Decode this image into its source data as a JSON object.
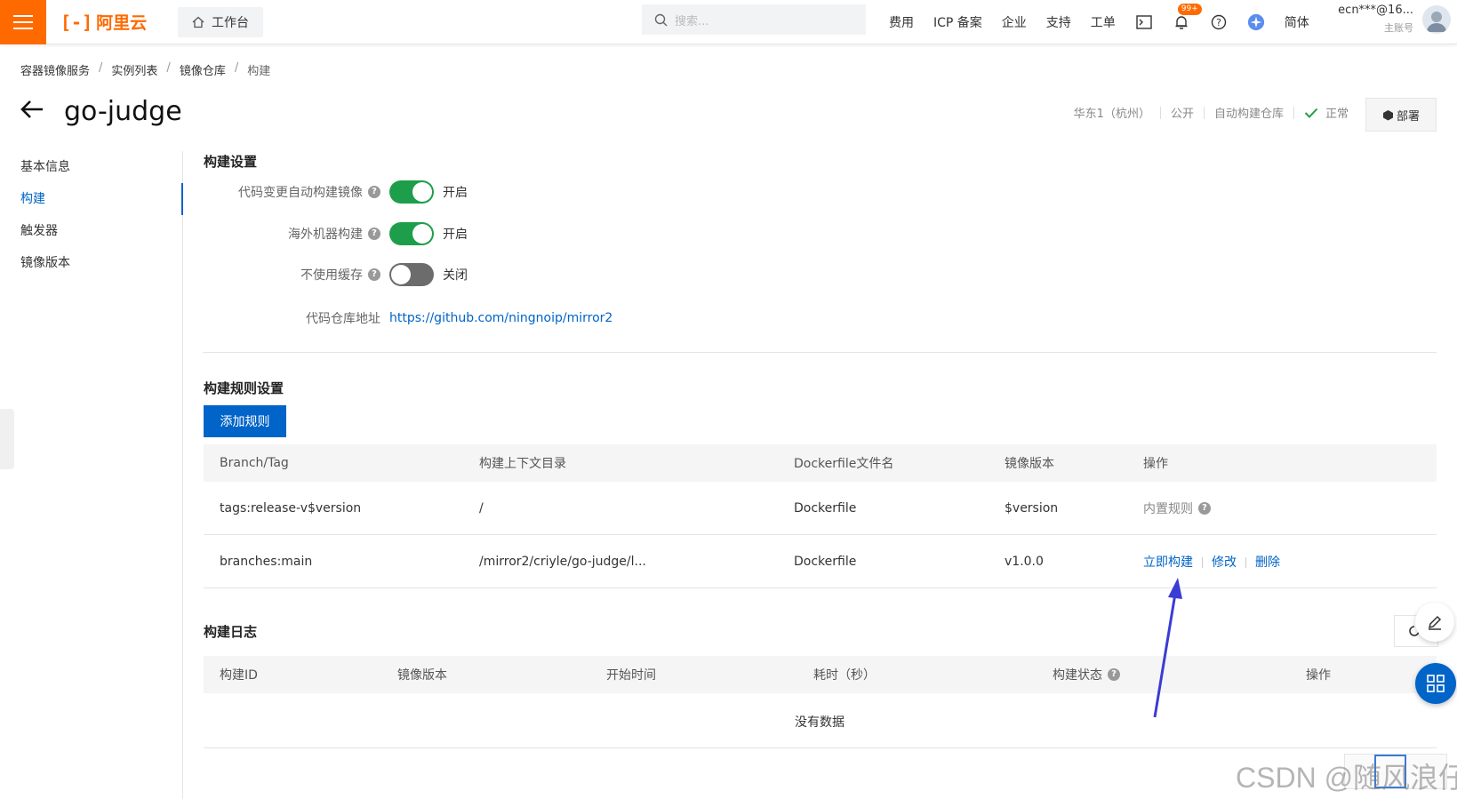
{
  "topbar": {
    "logo_mark": "[-]",
    "logo_text": "阿里云",
    "workbench": "工作台",
    "search_placeholder": "搜索...",
    "nav": [
      "费用",
      "ICP 备案",
      "企业",
      "支持",
      "工单"
    ],
    "badge": "99+",
    "language": "简体",
    "account_name": "ecn***@16...",
    "account_sub": "主账号"
  },
  "breadcrumb": [
    "容器镜像服务",
    "实例列表",
    "镜像仓库",
    "构建"
  ],
  "page": {
    "title": "go-judge",
    "meta": [
      "华东1（杭州）",
      "公开",
      "自动构建仓库"
    ],
    "status": "正常",
    "deploy_label": "部署"
  },
  "sidenav": {
    "items": [
      "基本信息",
      "构建",
      "触发器",
      "镜像版本"
    ],
    "active_index": 1
  },
  "build_settings": {
    "title": "构建设置",
    "rows": [
      {
        "label": "代码变更自动构建镜像",
        "state": "开启",
        "on": true
      },
      {
        "label": "海外机器构建",
        "state": "开启",
        "on": true
      },
      {
        "label": "不使用缓存",
        "state": "关闭",
        "on": false
      }
    ],
    "repo_label": "代码仓库地址",
    "repo_url": "https://github.com/ningnoip/mirror2"
  },
  "rules": {
    "title": "构建规则设置",
    "add_button": "添加规则",
    "columns": [
      "Branch/Tag",
      "构建上下文目录",
      "Dockerfile文件名",
      "镜像版本",
      "操作"
    ],
    "rows": [
      {
        "branch": "tags:release-v$version",
        "context": "/",
        "dockerfile": "Dockerfile",
        "version": "$version",
        "ops_text": "内置规则"
      },
      {
        "branch": "branches:main",
        "context": "/mirror2/criyle/go-judge/l...",
        "dockerfile": "Dockerfile",
        "version": "v1.0.0",
        "ops": [
          "立即构建",
          "修改",
          "删除"
        ]
      }
    ]
  },
  "logs": {
    "title": "构建日志",
    "columns": [
      "构建ID",
      "镜像版本",
      "开始时间",
      "耗时（秒）",
      "构建状态",
      "操作"
    ],
    "empty": "没有数据"
  },
  "watermark": "CSDN @随风浪仔",
  "colors": {
    "brand": "#ff6a00",
    "primary": "#0064c8",
    "switch_on": "#1e9e4a",
    "annotation": "#3b3bd6"
  }
}
